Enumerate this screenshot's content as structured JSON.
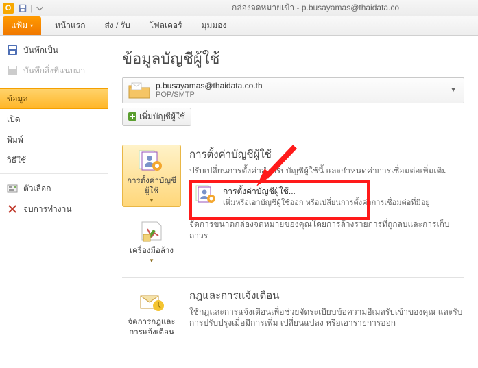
{
  "titlebar": {
    "title": "กล่องจดหมายเข้า - p.busayamas@thaidata.co"
  },
  "ribbon": {
    "file": "แฟ้ม",
    "home": "หน้าแรก",
    "sendreceive": "ส่ง / รับ",
    "folder": "โฟลเดอร์",
    "view": "มุมมอง"
  },
  "sidebar": {
    "saveas": "บันทึกเป็น",
    "saveattach": "บันทึกสิ่งที่แนบมา",
    "info": "ข้อมูล",
    "open": "เปิด",
    "print": "พิมพ์",
    "help": "วิธีใช้",
    "options": "ตัวเลือก",
    "exit": "จบการทำงาน"
  },
  "content": {
    "heading": "ข้อมูลบัญชีผู้ใช้",
    "account": {
      "address": "p.busayamas@thaidata.co.th",
      "protocol": "POP/SMTP"
    },
    "add_account": "เพิ่มบัญชีผู้ใช้",
    "sec_settings": {
      "btn": "การตั้งค่าบัญชีผู้ใช้",
      "title": "การตั้งค่าบัญชีผู้ใช้",
      "desc": "ปรับเปลี่ยนการตั้งค่าสำหรับบัญชีผู้ใช้นี้ และกำหนดค่าการเชื่อมต่อเพิ่มเติม",
      "sub_settings_title": "การตั้งค่าบัญชีผู้ใช้...",
      "sub_settings_desc": "เพิ่มหรือเอาบัญชีผู้ใช้ออก หรือเปลี่ยนการตั้งค่าการเชื่อมต่อที่มีอยู่"
    },
    "sec_cleanup": {
      "btn": "เครื่องมือล้าง",
      "desc": "จัดการขนาดกล่องจดหมายของคุณโดยการล้างรายการที่ถูกลบและการเก็บถาวร"
    },
    "sec_rules": {
      "btn": "จัดการกฎและการแจ้งเตือน",
      "title": "กฎและการแจ้งเตือน",
      "desc": "ใช้กฎและการแจ้งเตือนเพื่อช่วยจัดระเบียบข้อความอีเมลรับเข้าของคุณ และรับการปรับปรุงเมื่อมีการเพิ่ม เปลี่ยนแปลง หรือเอารายการออก"
    }
  }
}
